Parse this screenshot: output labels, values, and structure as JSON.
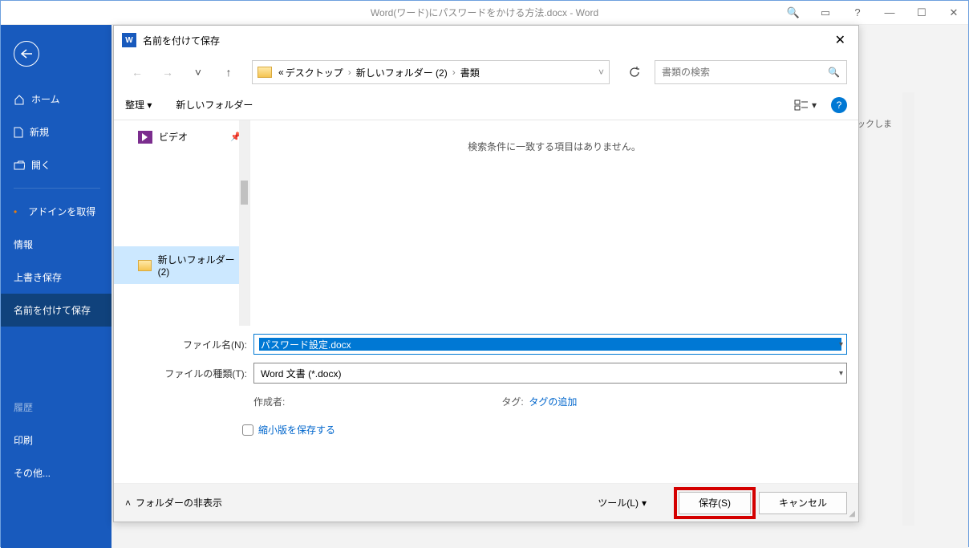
{
  "app": {
    "title_partial": "Word(ワード)にパスワードをかける方法.docx - Word"
  },
  "sidebar": {
    "home": "ホーム",
    "new": "新規",
    "open": "開く",
    "addins": "アドインを取得",
    "info": "情報",
    "save_over": "上書き保存",
    "save_as": "名前を付けて保存",
    "history": "履歴",
    "print": "印刷",
    "other": "その他..."
  },
  "hint": "リックしま",
  "dialog": {
    "title": "名前を付けて保存",
    "breadcrumb": {
      "prefix": "«",
      "p1": "デスクトップ",
      "p2": "新しいフォルダー (2)",
      "p3": "書類"
    },
    "search_placeholder": "書類の検索",
    "organize": "整理",
    "new_folder": "新しいフォルダー",
    "tree": {
      "video": "ビデオ",
      "folder2": "新しいフォルダー (2)"
    },
    "empty": "検索条件に一致する項目はありません。",
    "filename_label": "ファイル名(N):",
    "filename_value": "パスワード設定.docx",
    "filetype_label": "ファイルの種類(T):",
    "filetype_value": "Word 文書 (*.docx)",
    "author_label": "作成者:",
    "tag_label": "タグ:",
    "tag_link": "タグの追加",
    "thumb_label": "縮小版を保存する",
    "hide_folders": "フォルダーの非表示",
    "tools": "ツール(L)",
    "save": "保存(S)",
    "cancel": "キャンセル"
  }
}
